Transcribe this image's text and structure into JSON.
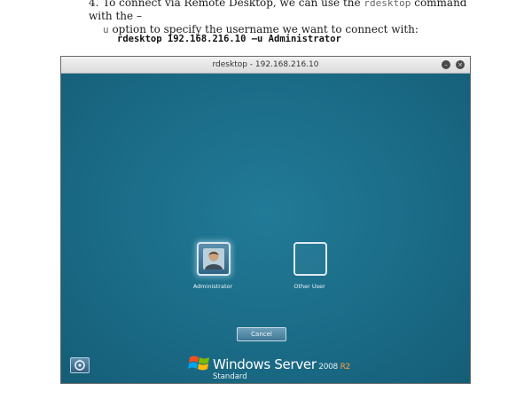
{
  "doc": {
    "step_number": "4.",
    "line1_a": "To connect via Remote Desktop, we can use the ",
    "line1_code": "rdesktop",
    "line1_b": " command with the –",
    "line2_code": "u",
    "line2_b": " option to specify the username we want to connect with:",
    "command": "rdesktop 192.168.216.10 –u Administrator"
  },
  "window": {
    "title": "rdesktop - 192.168.216.10",
    "minimize_glyph": "–",
    "close_glyph": "×"
  },
  "login": {
    "users": [
      {
        "label": "Administrator"
      },
      {
        "label": "Other User"
      }
    ],
    "cancel_label": "Cancel"
  },
  "branding": {
    "product": "Windows Server",
    "version_number": "2008",
    "version_suffix": "R2",
    "edition": "Standard"
  },
  "icons": {
    "user_avatar": "user-avatar-icon",
    "ease_of_access": "ease-of-access-icon",
    "windows_logo": "windows-flag-logo"
  },
  "colors": {
    "desktop_bg": "#1b6a86",
    "accent_r2": "#ff9f3a"
  }
}
